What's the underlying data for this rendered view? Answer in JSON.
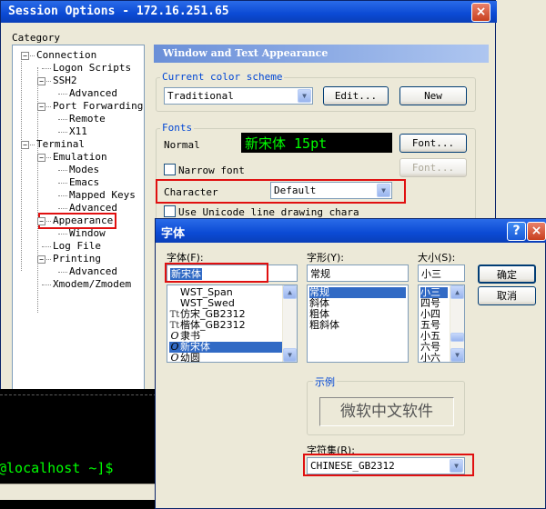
{
  "session_window": {
    "title": "Session Options - 172.16.251.65",
    "close_glyph": "×",
    "category_label": "Category",
    "tree": [
      {
        "label": "Connection",
        "level": 0
      },
      {
        "label": "Logon Scripts",
        "level": 1
      },
      {
        "label": "SSH2",
        "level": 1
      },
      {
        "label": "Advanced",
        "level": 2
      },
      {
        "label": "Port Forwarding",
        "level": 1
      },
      {
        "label": "Remote",
        "level": 2
      },
      {
        "label": "X11",
        "level": 2
      },
      {
        "label": "Terminal",
        "level": 0
      },
      {
        "label": "Emulation",
        "level": 1
      },
      {
        "label": "Modes",
        "level": 2
      },
      {
        "label": "Emacs",
        "level": 2
      },
      {
        "label": "Mapped Keys",
        "level": 2
      },
      {
        "label": "Advanced",
        "level": 2
      },
      {
        "label": "Appearance",
        "level": 1,
        "highlighted": true
      },
      {
        "label": "Window",
        "level": 2
      },
      {
        "label": "Log File",
        "level": 1
      },
      {
        "label": "Printing",
        "level": 1
      },
      {
        "label": "Advanced",
        "level": 2
      },
      {
        "label": "Xmodem/Zmodem",
        "level": 1
      }
    ],
    "panel_title": "Window and Text Appearance",
    "color_scheme_group": "Current color scheme",
    "color_scheme_value": "Traditional",
    "edit_button": "Edit...",
    "new_button": "New",
    "fonts_group": "Fonts",
    "normal_label": "Normal",
    "normal_preview": "新宋体 15pt",
    "font_button": "Font...",
    "narrow_font_label": "Narrow font",
    "font_button_disabled": "Font...",
    "character_label": "Character",
    "character_value": "Default",
    "unicode_label": "Use Unicode line drawing chara"
  },
  "terminal": {
    "prompt": "@localhost ~]$"
  },
  "font_dialog": {
    "title": "字体",
    "help_glyph": "?",
    "close_glyph": "×",
    "font_label": "字体(F):",
    "font_value": "新宋体",
    "font_list": [
      {
        "name": "WST_Span",
        "icon": ""
      },
      {
        "name": "WST_Swed",
        "icon": ""
      },
      {
        "name": "仿宋_GB2312",
        "icon": "Tt"
      },
      {
        "name": "楷体_GB2312",
        "icon": "Tt"
      },
      {
        "name": "隶书",
        "icon": "O"
      },
      {
        "name": "新宋体",
        "icon": "O",
        "selected": true
      },
      {
        "name": "幼圆",
        "icon": "O"
      }
    ],
    "style_label": "字形(Y):",
    "style_value": "常规",
    "style_list": [
      {
        "name": "常规",
        "selected": true
      },
      {
        "name": "斜体"
      },
      {
        "name": "粗体"
      },
      {
        "name": "粗斜体"
      }
    ],
    "size_label": "大小(S):",
    "size_value": "小三",
    "size_list": [
      {
        "name": "小三",
        "selected": true
      },
      {
        "name": "四号"
      },
      {
        "name": "小四"
      },
      {
        "name": "五号"
      },
      {
        "name": "小五"
      },
      {
        "name": "六号"
      },
      {
        "name": "小六"
      }
    ],
    "ok_button": "确定",
    "cancel_button": "取消",
    "sample_group": "示例",
    "sample_text": "微软中文软件",
    "charset_label": "字符集(R):",
    "charset_value": "CHINESE_GB2312"
  },
  "colors": {
    "titlebar": "#0b4ad4",
    "highlight_box": "#e01010",
    "preview_text": "#00ff00",
    "selection": "#316ac5"
  }
}
